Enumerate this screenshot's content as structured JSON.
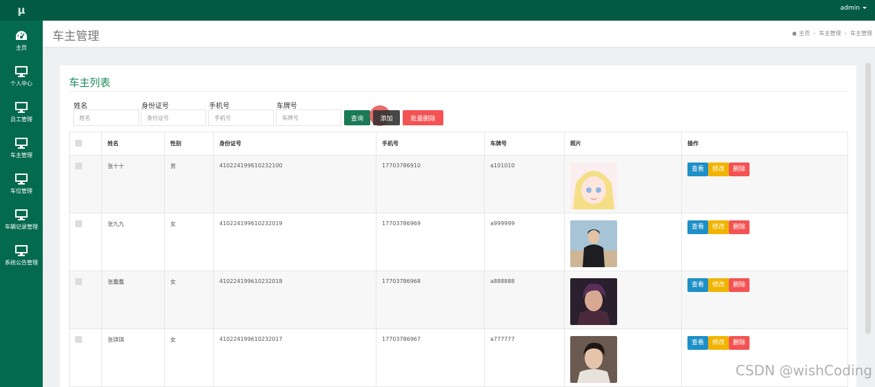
{
  "app": {
    "logo": "μ",
    "user": "admin"
  },
  "colors": {
    "topbar": "#045b44",
    "sidebar": "#046a4e",
    "accent": "#1a8a5a",
    "query": "#1a7a56",
    "add": "#333333",
    "batch_delete": "#f35353",
    "view": "#1e8fc7",
    "edit": "#f0b400",
    "delete": "#f35353"
  },
  "sidebar": {
    "items": [
      {
        "label": "主页",
        "icon": "dashboard-icon"
      },
      {
        "label": "个人中心",
        "icon": "monitor-icon"
      },
      {
        "label": "员工管理",
        "icon": "monitor-icon"
      },
      {
        "label": "车主管理",
        "icon": "monitor-icon"
      },
      {
        "label": "车位管理",
        "icon": "monitor-icon"
      },
      {
        "label": "车辆记录管理",
        "icon": "monitor-icon"
      },
      {
        "label": "系统公告管理",
        "icon": "monitor-icon"
      }
    ]
  },
  "header": {
    "title": "车主管理",
    "breadcrumb": [
      "主页",
      "车主管理",
      "车主管理"
    ]
  },
  "card": {
    "title": "车主列表"
  },
  "filters": [
    {
      "label": "姓名",
      "placeholder": "姓名"
    },
    {
      "label": "身份证号",
      "placeholder": "身份证号"
    },
    {
      "label": "手机号",
      "placeholder": "手机号"
    },
    {
      "label": "车牌号",
      "placeholder": "车牌号"
    }
  ],
  "buttons": {
    "query": "查询",
    "add": "添加",
    "batch_delete": "批量删除"
  },
  "table": {
    "headers": [
      "",
      "姓名",
      "性别",
      "身份证号",
      "手机号",
      "车牌号",
      "照片",
      "操作"
    ],
    "rows": [
      {
        "name": "张十十",
        "gender": "男",
        "id_card": "410224199610232100",
        "phone": "17703786910",
        "plate": "a101010"
      },
      {
        "name": "张九九",
        "gender": "女",
        "id_card": "410224199610232019",
        "phone": "17703786969",
        "plate": "a999999"
      },
      {
        "name": "张蠢蠢",
        "gender": "女",
        "id_card": "410224199610232018",
        "phone": "17703786968",
        "plate": "a888888"
      },
      {
        "name": "张琪琪",
        "gender": "女",
        "id_card": "410224199610232017",
        "phone": "17703786967",
        "plate": "a777777"
      }
    ],
    "actions": {
      "view": "查看",
      "edit": "修改",
      "delete": "删除"
    }
  },
  "watermark": "CSDN @wishCoding"
}
